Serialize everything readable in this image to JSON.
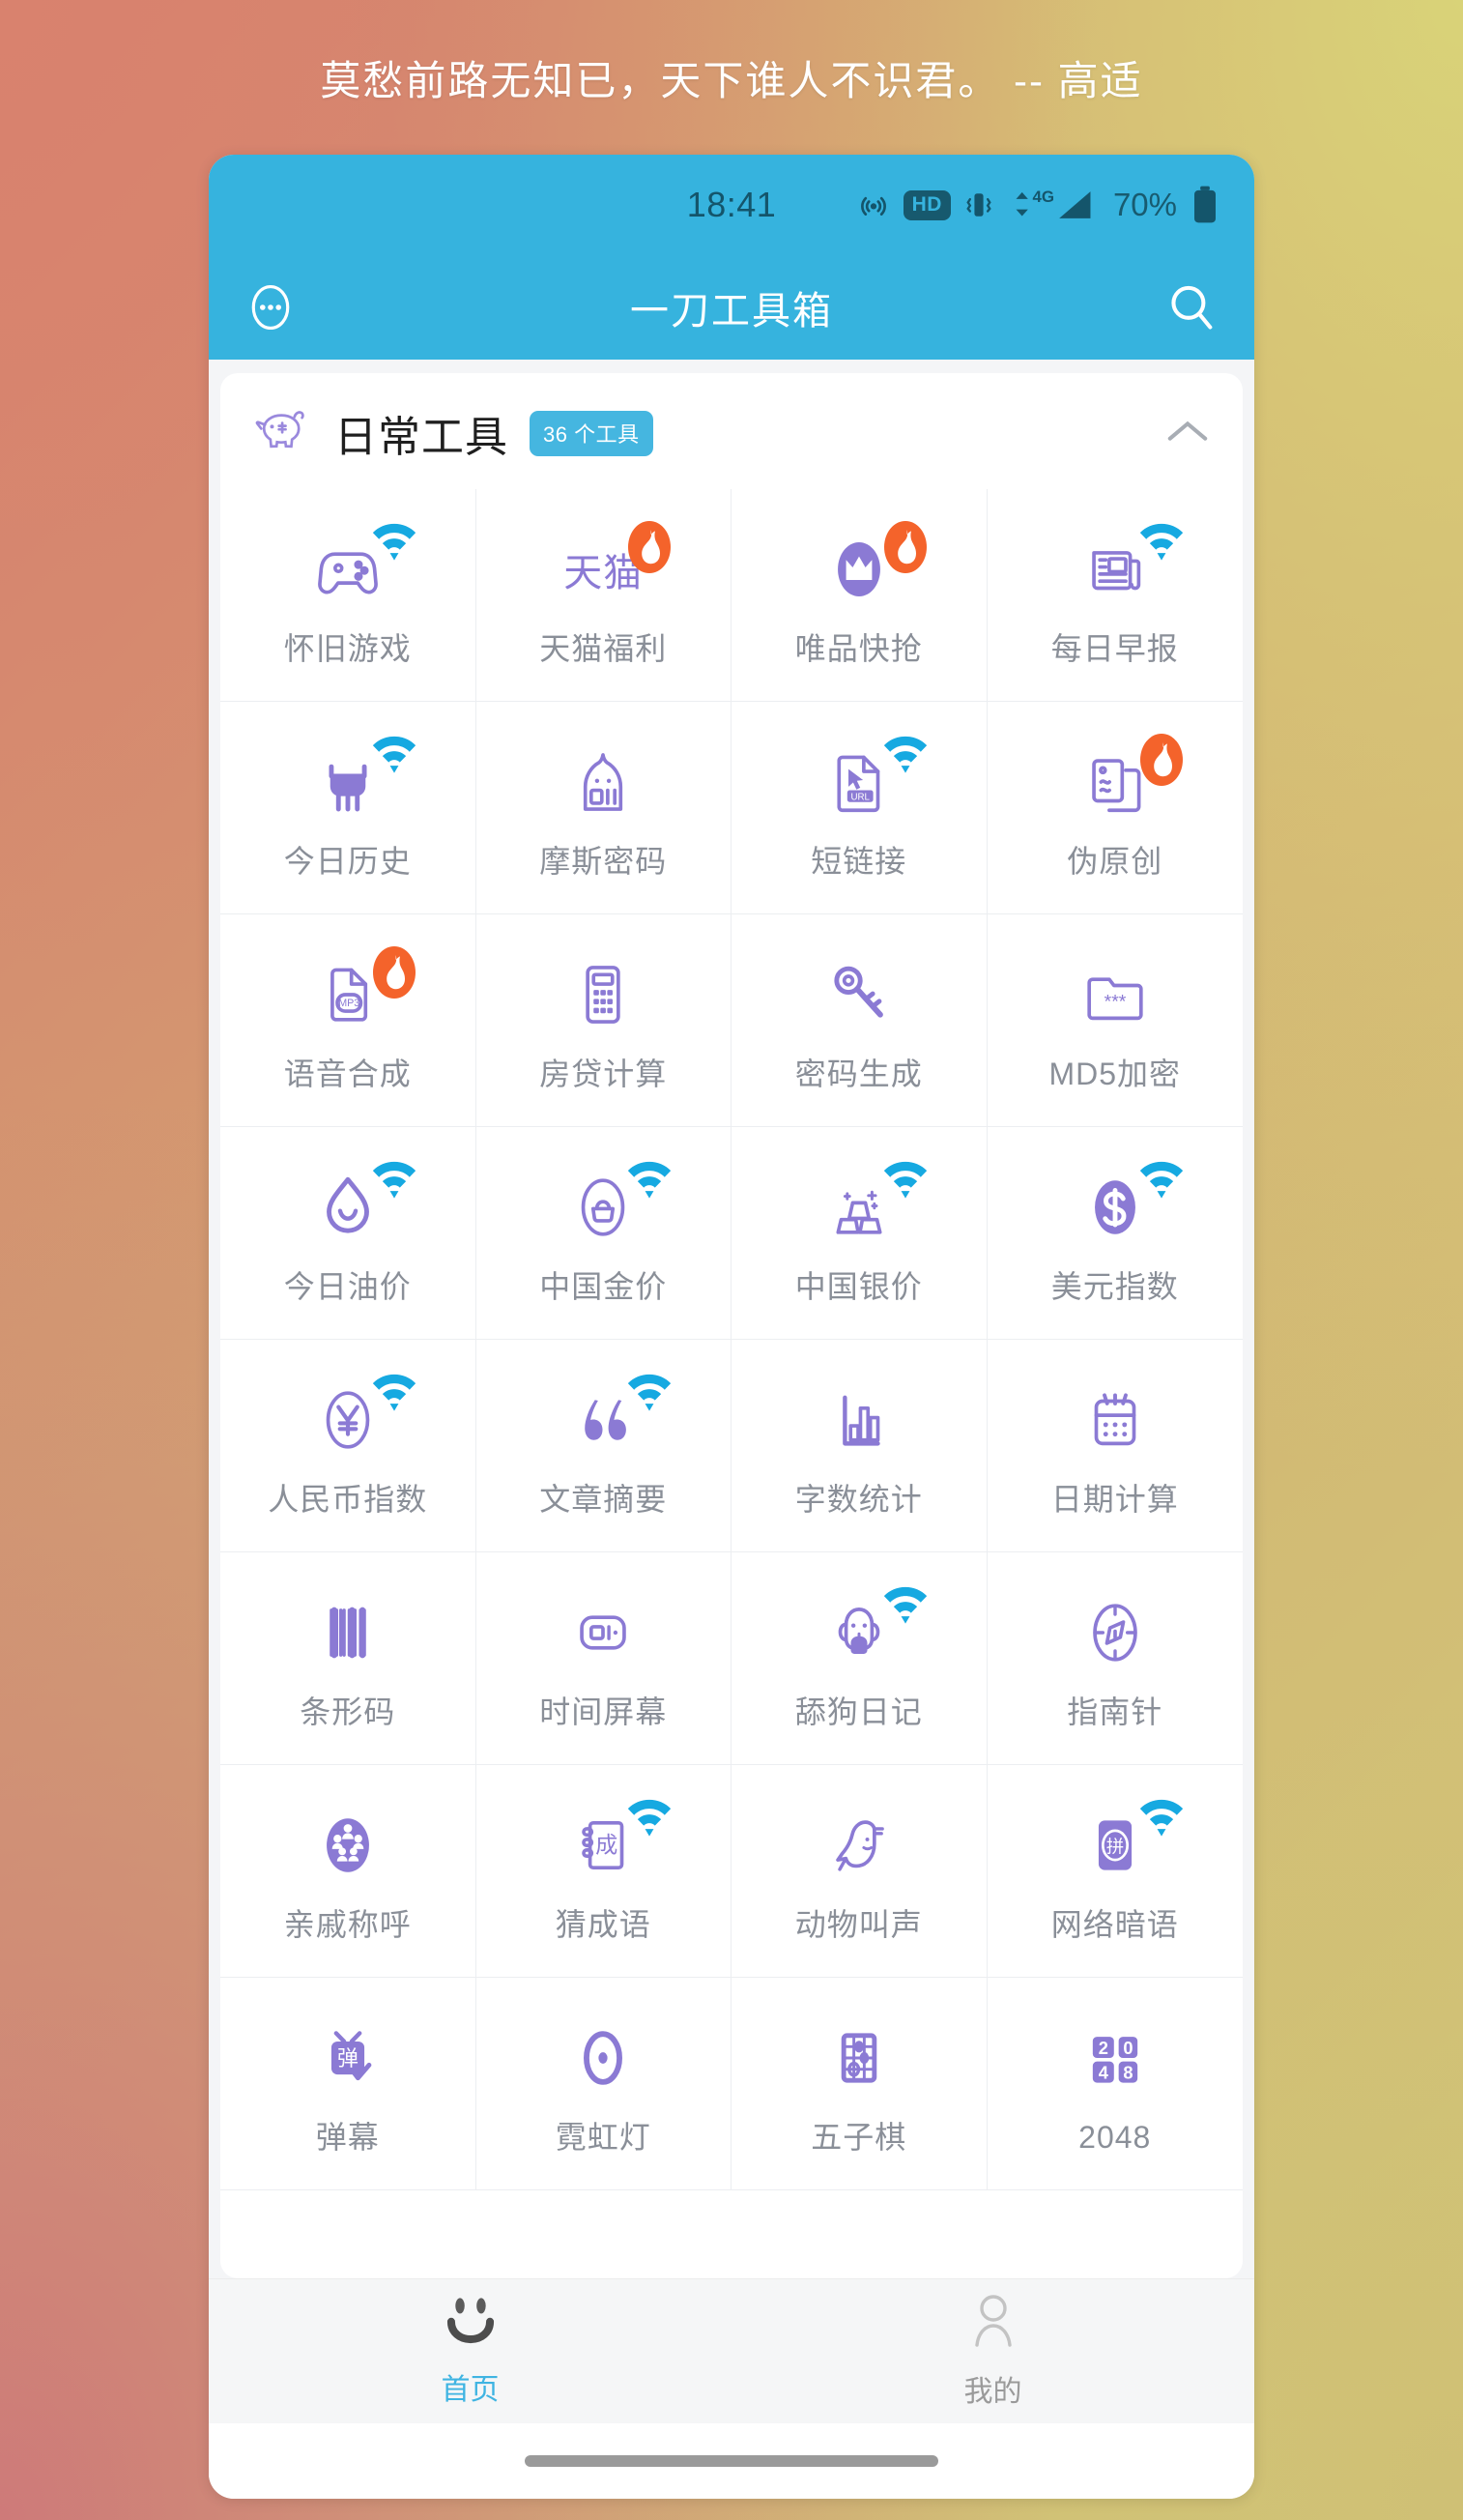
{
  "quote": "莫愁前路无知已，天下谁人不识君。 -- 高适",
  "colors": {
    "brand_blue": "#36b3de",
    "accent_purple": "#8b7ad4",
    "hot_orange": "#f4632b",
    "wifi_blue": "#16a9e1",
    "tab_active": "#3fb4e2",
    "label_gray": "#8a8f98",
    "bg_top_left": "#d9826e",
    "bg_top_right": "#d9d378",
    "bg_bottom_left": "#ce7a79",
    "bg_bottom_right": "#cfc075"
  },
  "statusbar": {
    "time": "18:41",
    "hd_label": "HD",
    "network_label": "4G",
    "battery_percent": "70%",
    "icons": [
      "hotspot-icon",
      "hd-badge-icon",
      "vibrate-icon",
      "data-transfer-icon",
      "signal-4g-icon",
      "battery-icon"
    ]
  },
  "appbar": {
    "title": "一刀工具箱",
    "left_icon": "more-ellipsis-circle-icon",
    "right_icon": "search-icon"
  },
  "section": {
    "icon": "piggy-bank-icon",
    "title": "日常工具",
    "badge": "36 个工具",
    "chevron": "chevron-up-icon"
  },
  "tools": [
    {
      "label": "怀旧游戏",
      "icon": "gamepad-icon",
      "badge": "wifi"
    },
    {
      "label": "天猫福利",
      "icon": "tmall-text-icon",
      "badge": "hot"
    },
    {
      "label": "唯品快抢",
      "icon": "crown-icon",
      "badge": "hot"
    },
    {
      "label": "每日早报",
      "icon": "newspaper-icon",
      "badge": "wifi"
    },
    {
      "label": "今日历史",
      "icon": "ding-cauldron-icon",
      "badge": "wifi"
    },
    {
      "label": "摩斯密码",
      "icon": "morse-ghost-icon",
      "badge": ""
    },
    {
      "label": "短链接",
      "icon": "url-file-icon",
      "badge": "wifi"
    },
    {
      "label": "伪原创",
      "icon": "document-copy-icon",
      "badge": "hot"
    },
    {
      "label": "语音合成",
      "icon": "mp3-file-icon",
      "badge": "hot"
    },
    {
      "label": "房贷计算",
      "icon": "calculator-icon",
      "badge": ""
    },
    {
      "label": "密码生成",
      "icon": "key-icon",
      "badge": ""
    },
    {
      "label": "MD5加密",
      "icon": "folder-lock-icon",
      "badge": ""
    },
    {
      "label": "今日油价",
      "icon": "oil-drop-icon",
      "badge": "wifi"
    },
    {
      "label": "中国金价",
      "icon": "gold-coin-icon",
      "badge": "wifi"
    },
    {
      "label": "中国银价",
      "icon": "silver-ingot-icon",
      "badge": "wifi"
    },
    {
      "label": "美元指数",
      "icon": "dollar-coin-icon",
      "badge": "wifi"
    },
    {
      "label": "人民币指数",
      "icon": "yuan-coin-icon",
      "badge": "wifi"
    },
    {
      "label": "文章摘要",
      "icon": "quote-marks-icon",
      "badge": "wifi"
    },
    {
      "label": "字数统计",
      "icon": "bar-chart-icon",
      "badge": ""
    },
    {
      "label": "日期计算",
      "icon": "calendar-icon",
      "badge": ""
    },
    {
      "label": "条形码",
      "icon": "barcode-icon",
      "badge": ""
    },
    {
      "label": "时间屏幕",
      "icon": "screen-clock-icon",
      "badge": ""
    },
    {
      "label": "舔狗日记",
      "icon": "dog-icon",
      "badge": "wifi"
    },
    {
      "label": "指南针",
      "icon": "compass-icon",
      "badge": ""
    },
    {
      "label": "亲戚称呼",
      "icon": "family-tree-icon",
      "badge": ""
    },
    {
      "label": "猜成语",
      "icon": "idiom-book-icon",
      "badge": "wifi"
    },
    {
      "label": "动物叫声",
      "icon": "bird-icon",
      "badge": ""
    },
    {
      "label": "网络暗语",
      "icon": "pinyin-card-icon",
      "badge": "wifi"
    },
    {
      "label": "弹幕",
      "icon": "danmaku-tv-icon",
      "badge": ""
    },
    {
      "label": "霓虹灯",
      "icon": "neon-light-icon",
      "badge": ""
    },
    {
      "label": "五子棋",
      "icon": "gomoku-board-icon",
      "badge": ""
    },
    {
      "label": "2048",
      "icon": "2048-tiles-icon",
      "badge": ""
    }
  ],
  "tabbar": {
    "items": [
      {
        "label": "首页",
        "icon": "smiley-face-icon",
        "active": true
      },
      {
        "label": "我的",
        "icon": "person-icon",
        "active": false
      }
    ]
  }
}
